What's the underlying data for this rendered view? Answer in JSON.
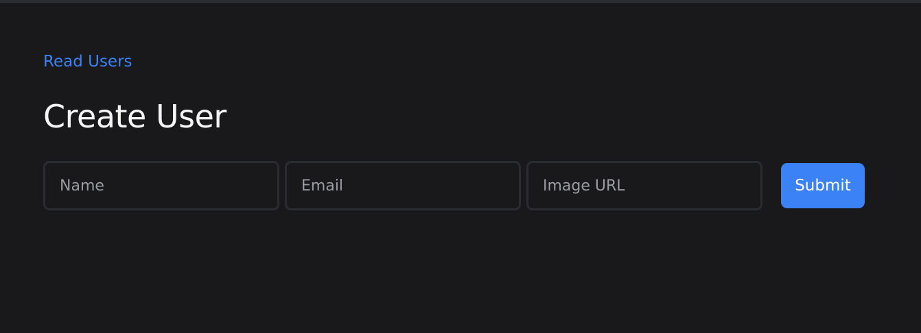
{
  "nav": {
    "read_users_link": "Read Users"
  },
  "page": {
    "title": "Create User"
  },
  "form": {
    "name_placeholder": "Name",
    "name_value": "",
    "email_placeholder": "Email",
    "email_value": "",
    "image_url_placeholder": "Image URL",
    "image_url_value": "",
    "submit_label": "Submit"
  },
  "colors": {
    "background": "#19191b",
    "accent": "#3b82f6",
    "input_border": "#2b2c2f"
  }
}
